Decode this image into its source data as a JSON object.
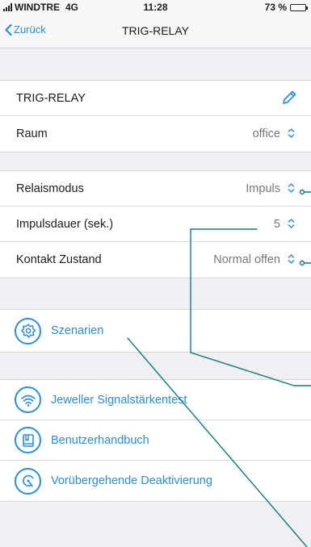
{
  "status_bar": {
    "carrier": "WINDTRE",
    "network": "4G",
    "time": "11:28",
    "battery": "73 %",
    "battery_level": 0.73
  },
  "nav": {
    "back_label": "Zurück",
    "title": "TRIG-RELAY"
  },
  "device": {
    "name": "TRIG-RELAY",
    "room_label": "Raum",
    "room_value": "office"
  },
  "settings": {
    "relay_mode_label": "Relaismodus",
    "relay_mode_value": "Impuls",
    "impulse_duration_label": "Impulsdauer (sek.)",
    "impulse_duration_value": "5",
    "contact_state_label": "Kontakt Zustand",
    "contact_state_value": "Normal offen"
  },
  "scenarios": {
    "label": "Szenarien"
  },
  "tools": {
    "signal_test": "Jeweller Signalstärkentest",
    "manual": "Benutzerhandbuch",
    "deactivation": "Vorübergehende Deaktivierung"
  },
  "colors": {
    "accent": "#2a8ddf",
    "annotation": "#0f7d78"
  },
  "icons": [
    "back-chevron-icon",
    "pencil-icon",
    "updown-chevron-icon",
    "scenario-gear-icon",
    "signal-wifi-icon",
    "manual-book-icon",
    "deactivation-icon"
  ]
}
